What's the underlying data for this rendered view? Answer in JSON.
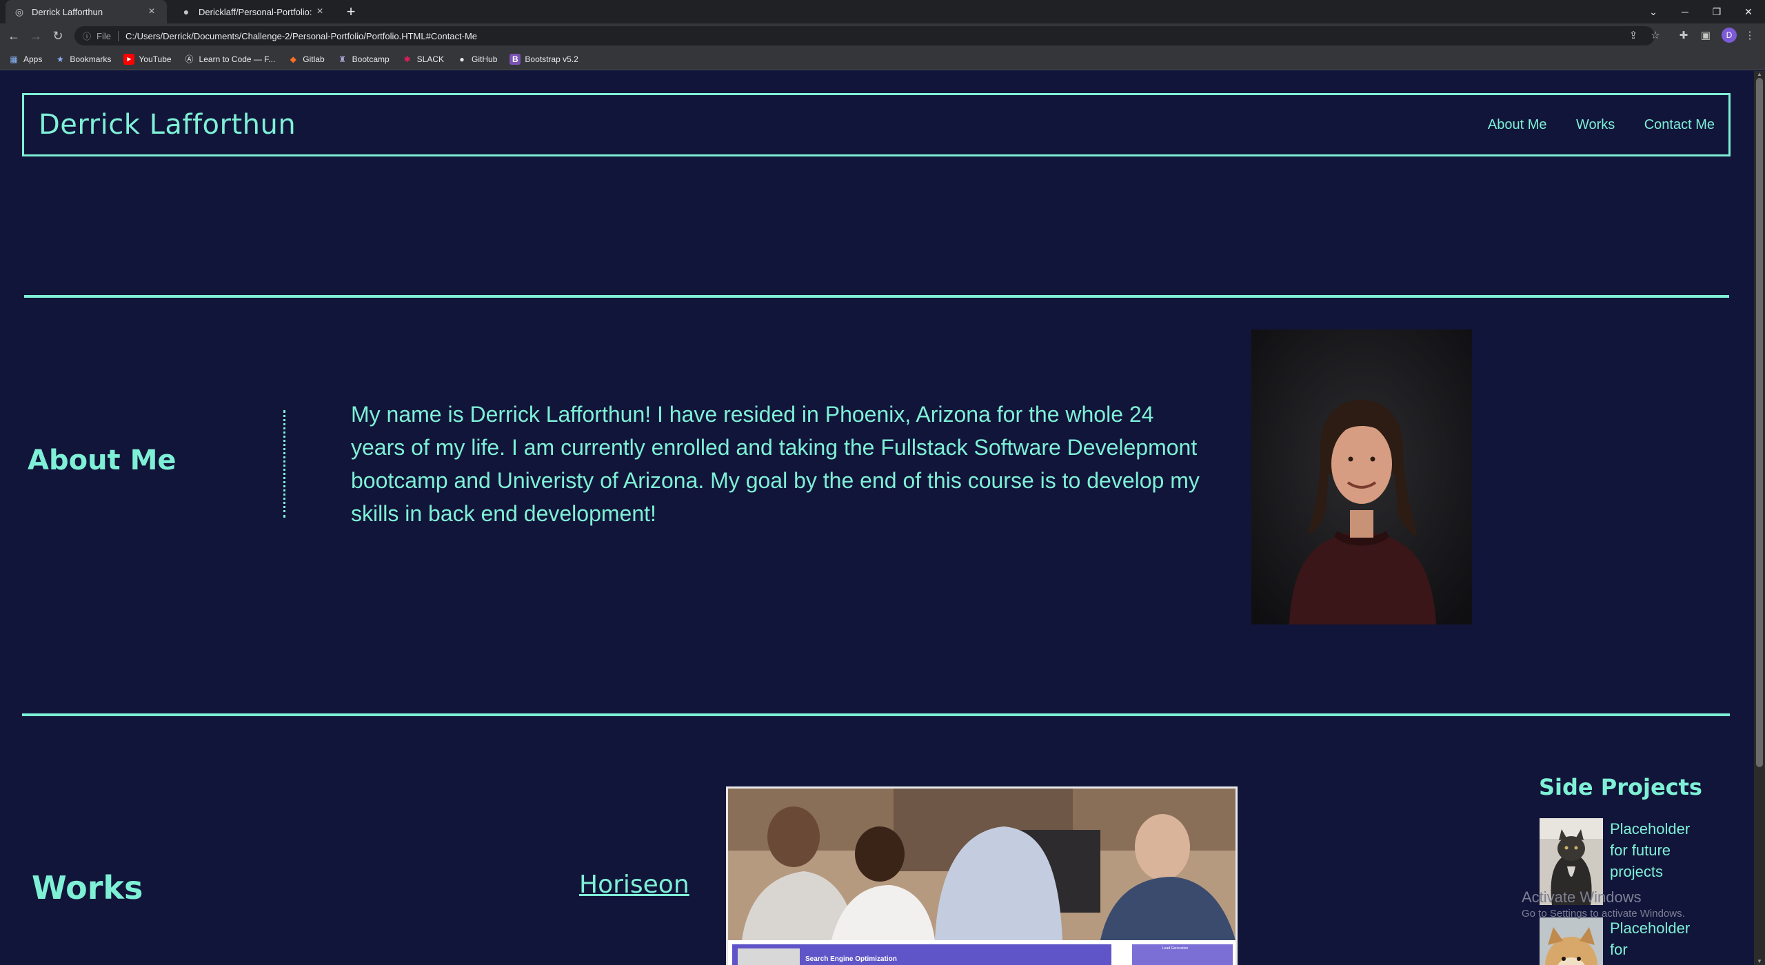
{
  "browser": {
    "tabs": [
      {
        "title": "Derrick Lafforthun",
        "icon": "globe-icon",
        "active": true
      },
      {
        "title": "Dericklaff/Personal-Portfolio: Cr",
        "icon": "github-icon",
        "active": false
      }
    ],
    "new_tab": "+",
    "window_controls": {
      "minimize": "─",
      "restore": "❐",
      "close": "✕",
      "tab_search": "⌄"
    },
    "nav": {
      "back": "←",
      "forward": "→",
      "reload": "↻"
    },
    "address": {
      "info": "ⓘ",
      "scheme": "File",
      "url": "C:/Users/Derrick/Documents/Challenge-2/Personal-Portfolio/Portfolio.HTML#Contact-Me"
    },
    "toolbar_icons": {
      "share": "⇪",
      "bookmark_star": "☆",
      "extensions": "✚",
      "sidebar": "▣",
      "menu": "⋮"
    },
    "profile_initial": "D",
    "bookmarks": [
      {
        "label": "Apps",
        "icon": "apps-icon"
      },
      {
        "label": "Bookmarks",
        "icon": "star-icon"
      },
      {
        "label": "YouTube",
        "icon": "youtube-icon"
      },
      {
        "label": "Learn to Code — F...",
        "icon": "freecodecamp-icon"
      },
      {
        "label": "Gitlab",
        "icon": "gitlab-icon"
      },
      {
        "label": "Bootcamp",
        "icon": "bootcamp-icon"
      },
      {
        "label": "SLACK",
        "icon": "slack-icon"
      },
      {
        "label": "GitHub",
        "icon": "github-icon"
      },
      {
        "label": "Bootstrap v5.2",
        "icon": "bootstrap-icon"
      }
    ]
  },
  "site": {
    "brand": "Derrick Lafforthun",
    "nav": [
      "About Me",
      "Works",
      "Contact Me"
    ],
    "about": {
      "title": "About Me",
      "text": "My name is Derrick Lafforthun! I have resided in Phoenix, Arizona for the whole 24 years of my life. I am currently enrolled and taking the Fullstack Software Develepmont bootcamp and Univeristy of Arizona. My goal by the end of this course is to develop my skills in back end development!"
    },
    "works": {
      "title": "Works",
      "featured_link": "Horiseon",
      "screenshot_caption": "Search Engine Optimization",
      "screenshot_side_caption": "Lead Generation"
    },
    "side_projects": {
      "title": "Side Projects",
      "items": [
        {
          "label": "Placeholder for future projects"
        },
        {
          "label": "Placeholder for"
        }
      ]
    }
  },
  "os_watermark": {
    "line1": "Activate Windows",
    "line2": "Go to Settings to activate Windows."
  },
  "colors": {
    "accent": "#7ef0d6",
    "background": "#12153a",
    "chrome_dark": "#202124",
    "chrome": "#35363a"
  }
}
